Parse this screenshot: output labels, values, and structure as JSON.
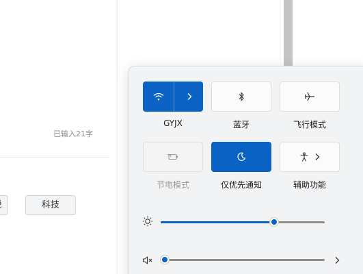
{
  "background": {
    "char_count": "已输入21字",
    "tags": [
      {
        "label": "锐"
      },
      {
        "label": "科技"
      }
    ]
  },
  "quick_settings": {
    "tiles": [
      {
        "name": "wifi",
        "label": "GYJX",
        "state": "on",
        "icon": "wifi-icon",
        "has_expand": true
      },
      {
        "name": "bluetooth",
        "label": "蓝牙",
        "state": "off",
        "icon": "bluetooth-icon"
      },
      {
        "name": "airplane",
        "label": "飞行模式",
        "state": "off",
        "icon": "airplane-icon"
      },
      {
        "name": "battery-saver",
        "label": "节电模式",
        "state": "disabled",
        "icon": "battery-saver-icon"
      },
      {
        "name": "focus-assist",
        "label": "仅优先通知",
        "state": "on",
        "icon": "moon-icon"
      },
      {
        "name": "accessibility",
        "label": "辅助功能",
        "state": "off",
        "icon": "accessibility-icon",
        "has_expand": true
      }
    ],
    "brightness": {
      "icon": "sun-icon",
      "level": 0.69
    },
    "volume": {
      "icon": "speaker-muted-icon",
      "level": 0.0,
      "expand_icon": "chevron-right-icon"
    }
  },
  "colors": {
    "accent": "#0a62c4",
    "panel_bg": "#f2f3f5",
    "track": "#8d8d8d"
  }
}
